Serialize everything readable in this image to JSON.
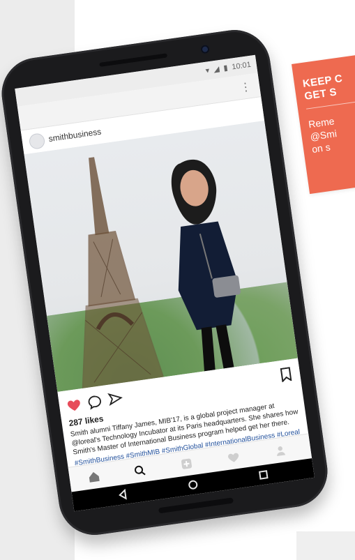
{
  "callout": {
    "heading": "KEEP C\nGET S",
    "body": "Reme\n@Smi\non s"
  },
  "status": {
    "time": "10:01"
  },
  "post": {
    "username": "smithbusiness",
    "likes": "287 likes",
    "caption": "Smith alumni Tiffany James, MIB'17, is a global project manager at @loreal's Technology Incubator at its Paris headquarters. She shares how Smith's Master of International Business program helped get her there.",
    "hashtags": "#SmithBusiness #SmithMIB #SmithGlobal #InternationalBusiness #Loreal"
  },
  "icons": {
    "heart": "heart-icon",
    "comment": "comment-icon",
    "share": "share-icon",
    "bookmark": "bookmark-icon",
    "home": "home-icon",
    "search": "search-icon",
    "add": "add-post-icon",
    "activity": "activity-heart-icon",
    "profile": "profile-icon",
    "back": "back-triangle-icon",
    "homeNav": "home-circle-icon",
    "recents": "recents-square-icon"
  },
  "colors": {
    "callout": "#ee6a50",
    "hashtags": "#1f4e9a",
    "heart": "#e74c5a"
  }
}
